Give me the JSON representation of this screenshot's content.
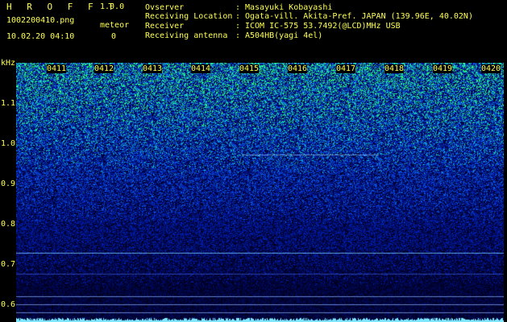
{
  "header": {
    "app_title": "H R O F F T",
    "version": "1.0.0",
    "file_name": "1002200410.png",
    "date_time": "10.02.20 04:10",
    "meteor_label": "meteor",
    "meteor_count": "0"
  },
  "info": [
    {
      "key": "Ovserver",
      "value": "Masayuki Kobayashi"
    },
    {
      "key": "Receiving Location",
      "value": "Ogata-vill. Akita-Pref. JAPAN (139.96E, 40.02N)"
    },
    {
      "key": "Receiver",
      "value": "ICOM IC-575 53.7492(@LCD)MHz USB"
    },
    {
      "key": "Receiving antenna",
      "value": "A504HB(yagi 4el)"
    }
  ],
  "axis": {
    "unit": "kHz",
    "freq_labels": [
      "1.1",
      "1.0",
      "0.9",
      "0.8",
      "0.7",
      "0.6"
    ],
    "time_labels": [
      "0411",
      "0412",
      "0413",
      "0414",
      "0415",
      "0416",
      "0417",
      "0418",
      "0419",
      "0420"
    ]
  },
  "colors": {
    "text_yellow": "#ffff55",
    "text_green": "#66ff33",
    "background": "#000000",
    "noise_low": "#000a40",
    "noise_high": "#30ff70"
  }
}
